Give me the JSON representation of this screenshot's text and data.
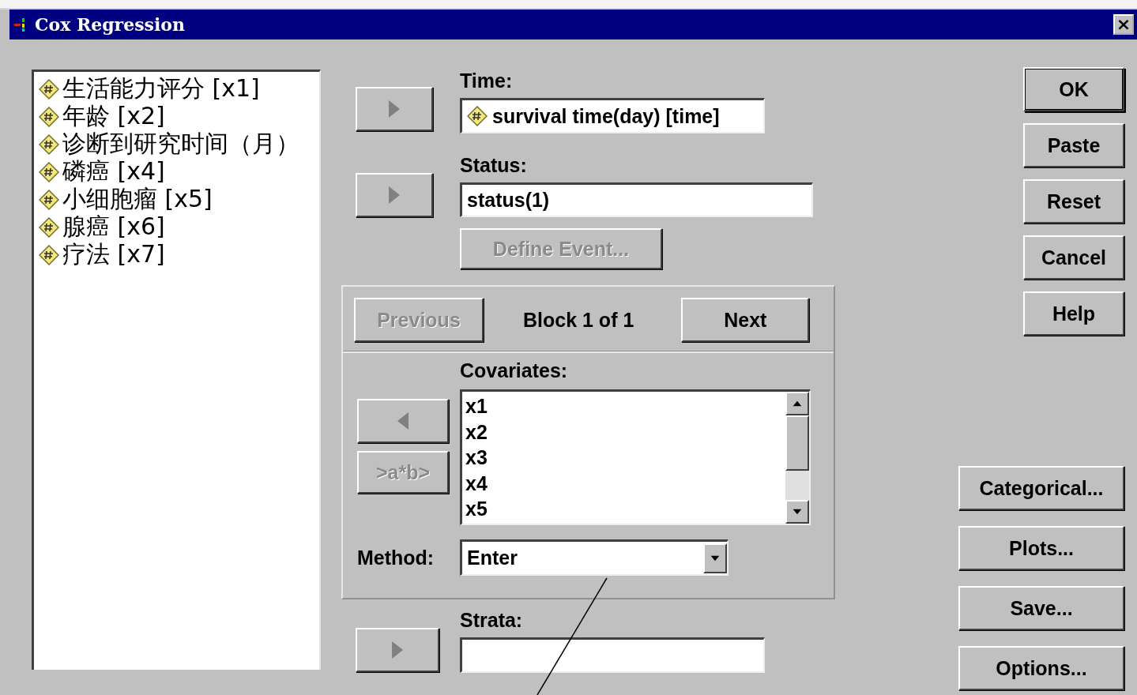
{
  "window": {
    "title": "Cox Regression",
    "close": "×"
  },
  "variables": [
    {
      "label": "生活能力评分 [x1]"
    },
    {
      "label": "年龄 [x2]"
    },
    {
      "label": "诊断到研究时间（月）"
    },
    {
      "label": "磷癌 [x4]"
    },
    {
      "label": "小细胞瘤 [x5]"
    },
    {
      "label": "腺癌 [x6]"
    },
    {
      "label": "疗法 [x7]"
    }
  ],
  "time": {
    "label": "Time:",
    "value": "survival time(day) [time]"
  },
  "status": {
    "label": "Status:",
    "value": "status(1)"
  },
  "define_event": {
    "label": "Define Event...",
    "disabled": true
  },
  "block": {
    "previous": {
      "label": "Previous",
      "disabled": true
    },
    "text": "Block 1 of 1",
    "next": {
      "label": "Next",
      "disabled": false
    }
  },
  "covariates": {
    "label": "Covariates:",
    "items": [
      "x1",
      "x2",
      "x3",
      "x4",
      "x5"
    ],
    "interaction_button": {
      "label": ">a*b>",
      "disabled": true
    }
  },
  "method": {
    "label": "Method:",
    "value": "Enter"
  },
  "strata": {
    "label": "Strata:"
  },
  "main_buttons": [
    {
      "label": "OK",
      "default": true
    },
    {
      "label": "Paste",
      "default": false
    },
    {
      "label": "Reset",
      "default": false
    },
    {
      "label": "Cancel",
      "default": false
    },
    {
      "label": "Help",
      "default": false
    }
  ],
  "option_buttons": [
    {
      "label": "Categorical..."
    },
    {
      "label": "Plots..."
    },
    {
      "label": "Save..."
    },
    {
      "label": "Options..."
    }
  ]
}
